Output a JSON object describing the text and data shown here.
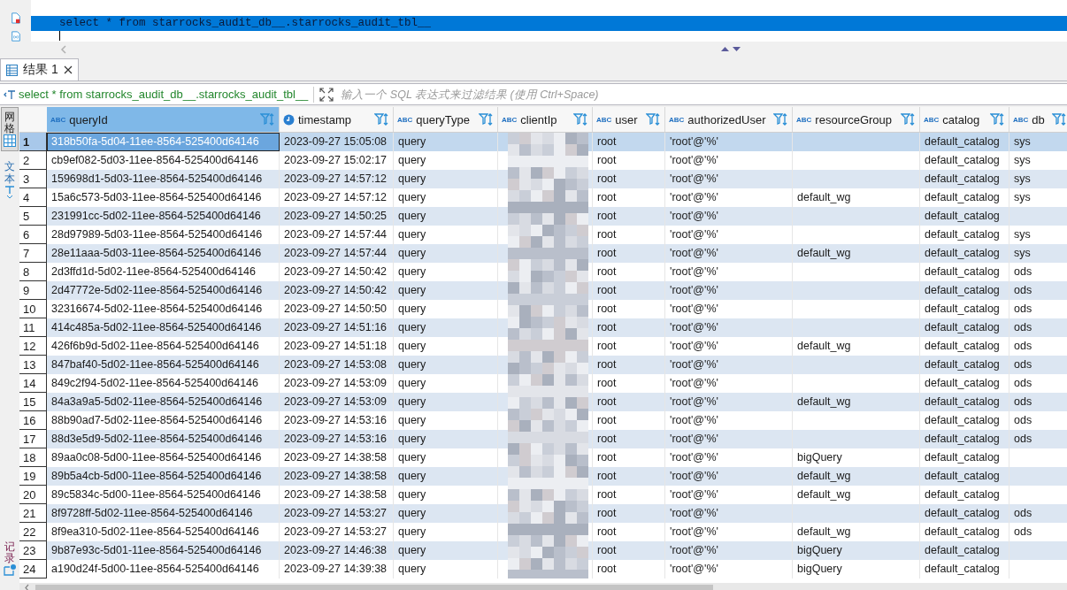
{
  "editor": {
    "selected_line": "select * from starrocks_audit_db__.starrocks_audit_tbl__"
  },
  "result_tab": {
    "label": "结果 1"
  },
  "filter": {
    "query": "select * from starrocks_audit_db__.starrocks_audit_tbl__",
    "placeholder": "输入一个 SQL 表达式来过滤结果 (使用 Ctrl+Space)"
  },
  "view_tabs": [
    {
      "label": "网格",
      "kind": "grid",
      "selected": true
    },
    {
      "label": "文本",
      "kind": "text",
      "selected": false
    }
  ],
  "record_tab": {
    "label": "记录"
  },
  "table": {
    "columns": [
      {
        "label": "queryId",
        "kind": "string",
        "type_label": "ABC",
        "selected": true
      },
      {
        "label": "timestamp",
        "kind": "time",
        "selected": false
      },
      {
        "label": "queryType",
        "kind": "string",
        "type_label": "ABC",
        "selected": false
      },
      {
        "label": "clientIp",
        "kind": "string",
        "type_label": "ABC",
        "selected": false,
        "redacted": true
      },
      {
        "label": "user",
        "kind": "string",
        "type_label": "ABC",
        "selected": false
      },
      {
        "label": "authorizedUser",
        "kind": "string",
        "type_label": "ABC",
        "selected": false
      },
      {
        "label": "resourceGroup",
        "kind": "string",
        "type_label": "ABC",
        "selected": false
      },
      {
        "label": "catalog",
        "kind": "string",
        "type_label": "ABC",
        "selected": false
      },
      {
        "label": "db",
        "kind": "string",
        "type_label": "ABC",
        "selected": false
      }
    ],
    "rows": [
      {
        "number": "1",
        "selected": true,
        "cells": [
          "318b50fa-5d04-11ee-8564-525400d64146",
          "2023-09-27 15:05:08",
          "query",
          null,
          "root",
          "'root'@'%'",
          null,
          "default_catalog",
          "sys"
        ]
      },
      {
        "number": "2",
        "selected": false,
        "cells": [
          "cb9ef082-5d03-11ee-8564-525400d64146",
          "2023-09-27 15:02:17",
          "query",
          null,
          "root",
          "'root'@'%'",
          null,
          "default_catalog",
          "sys"
        ]
      },
      {
        "number": "3",
        "selected": false,
        "cells": [
          "159698d1-5d03-11ee-8564-525400d64146",
          "2023-09-27 14:57:12",
          "query",
          null,
          "root",
          "'root'@'%'",
          null,
          "default_catalog",
          "sys"
        ]
      },
      {
        "number": "4",
        "selected": false,
        "cells": [
          "15a6c573-5d03-11ee-8564-525400d64146",
          "2023-09-27 14:57:12",
          "query",
          null,
          "root",
          "'root'@'%'",
          "default_wg",
          "default_catalog",
          "sys"
        ]
      },
      {
        "number": "5",
        "selected": false,
        "cells": [
          "231991cc-5d02-11ee-8564-525400d64146",
          "2023-09-27 14:50:25",
          "query",
          null,
          "root",
          "'root'@'%'",
          null,
          "default_catalog",
          null
        ]
      },
      {
        "number": "6",
        "selected": false,
        "cells": [
          "28d97989-5d03-11ee-8564-525400d64146",
          "2023-09-27 14:57:44",
          "query",
          null,
          "root",
          "'root'@'%'",
          null,
          "default_catalog",
          "sys"
        ]
      },
      {
        "number": "7",
        "selected": false,
        "cells": [
          "28e11aaa-5d03-11ee-8564-525400d64146",
          "2023-09-27 14:57:44",
          "query",
          null,
          "root",
          "'root'@'%'",
          "default_wg",
          "default_catalog",
          "sys"
        ]
      },
      {
        "number": "8",
        "selected": false,
        "cells": [
          "2d3ffd1d-5d02-11ee-8564-525400d64146",
          "2023-09-27 14:50:42",
          "query",
          null,
          "root",
          "'root'@'%'",
          null,
          "default_catalog",
          "ods"
        ]
      },
      {
        "number": "9",
        "selected": false,
        "cells": [
          "2d47772e-5d02-11ee-8564-525400d64146",
          "2023-09-27 14:50:42",
          "query",
          null,
          "root",
          "'root'@'%'",
          null,
          "default_catalog",
          "ods"
        ]
      },
      {
        "number": "10",
        "selected": false,
        "cells": [
          "32316674-5d02-11ee-8564-525400d64146",
          "2023-09-27 14:50:50",
          "query",
          null,
          "root",
          "'root'@'%'",
          null,
          "default_catalog",
          "ods"
        ]
      },
      {
        "number": "11",
        "selected": false,
        "cells": [
          "414c485a-5d02-11ee-8564-525400d64146",
          "2023-09-27 14:51:16",
          "query",
          null,
          "root",
          "'root'@'%'",
          null,
          "default_catalog",
          "ods"
        ]
      },
      {
        "number": "12",
        "selected": false,
        "cells": [
          "426f6b9d-5d02-11ee-8564-525400d64146",
          "2023-09-27 14:51:18",
          "query",
          null,
          "root",
          "'root'@'%'",
          "default_wg",
          "default_catalog",
          "ods"
        ]
      },
      {
        "number": "13",
        "selected": false,
        "cells": [
          "847baf40-5d02-11ee-8564-525400d64146",
          "2023-09-27 14:53:08",
          "query",
          null,
          "root",
          "'root'@'%'",
          null,
          "default_catalog",
          "ods"
        ]
      },
      {
        "number": "14",
        "selected": false,
        "cells": [
          "849c2f94-5d02-11ee-8564-525400d64146",
          "2023-09-27 14:53:09",
          "query",
          null,
          "root",
          "'root'@'%'",
          null,
          "default_catalog",
          "ods"
        ]
      },
      {
        "number": "15",
        "selected": false,
        "cells": [
          "84a3a9a5-5d02-11ee-8564-525400d64146",
          "2023-09-27 14:53:09",
          "query",
          null,
          "root",
          "'root'@'%'",
          "default_wg",
          "default_catalog",
          "ods"
        ]
      },
      {
        "number": "16",
        "selected": false,
        "cells": [
          "88b90ad7-5d02-11ee-8564-525400d64146",
          "2023-09-27 14:53:16",
          "query",
          null,
          "root",
          "'root'@'%'",
          null,
          "default_catalog",
          "ods"
        ]
      },
      {
        "number": "17",
        "selected": false,
        "cells": [
          "88d3e5d9-5d02-11ee-8564-525400d64146",
          "2023-09-27 14:53:16",
          "query",
          null,
          "root",
          "'root'@'%'",
          null,
          "default_catalog",
          "ods"
        ]
      },
      {
        "number": "18",
        "selected": false,
        "cells": [
          "89aa0c08-5d00-11ee-8564-525400d64146",
          "2023-09-27 14:38:58",
          "query",
          null,
          "root",
          "'root'@'%'",
          "bigQuery",
          "default_catalog",
          null
        ]
      },
      {
        "number": "19",
        "selected": false,
        "cells": [
          "89b5a4cb-5d00-11ee-8564-525400d64146",
          "2023-09-27 14:38:58",
          "query",
          null,
          "root",
          "'root'@'%'",
          "default_wg",
          "default_catalog",
          null
        ]
      },
      {
        "number": "20",
        "selected": false,
        "cells": [
          "89c5834c-5d00-11ee-8564-525400d64146",
          "2023-09-27 14:38:58",
          "query",
          null,
          "root",
          "'root'@'%'",
          "default_wg",
          "default_catalog",
          null
        ]
      },
      {
        "number": "21",
        "selected": false,
        "cells": [
          "8f9728ff-5d02-11ee-8564-525400d64146",
          "2023-09-27 14:53:27",
          "query",
          null,
          "root",
          "'root'@'%'",
          null,
          "default_catalog",
          "ods"
        ]
      },
      {
        "number": "22",
        "selected": false,
        "cells": [
          "8f9ea310-5d02-11ee-8564-525400d64146",
          "2023-09-27 14:53:27",
          "query",
          null,
          "root",
          "'root'@'%'",
          "default_wg",
          "default_catalog",
          "ods"
        ]
      },
      {
        "number": "23",
        "selected": false,
        "cells": [
          "9b87e93c-5d01-11ee-8564-525400d64146",
          "2023-09-27 14:46:38",
          "query",
          null,
          "root",
          "'root'@'%'",
          "bigQuery",
          "default_catalog",
          null
        ]
      },
      {
        "number": "24",
        "selected": false,
        "cells": [
          "a190d24f-5d00-11ee-8564-525400d64146",
          "2023-09-27 14:39:38",
          "query",
          null,
          "root",
          "'root'@'%'",
          "bigQuery",
          "default_catalog",
          null
        ]
      }
    ]
  }
}
